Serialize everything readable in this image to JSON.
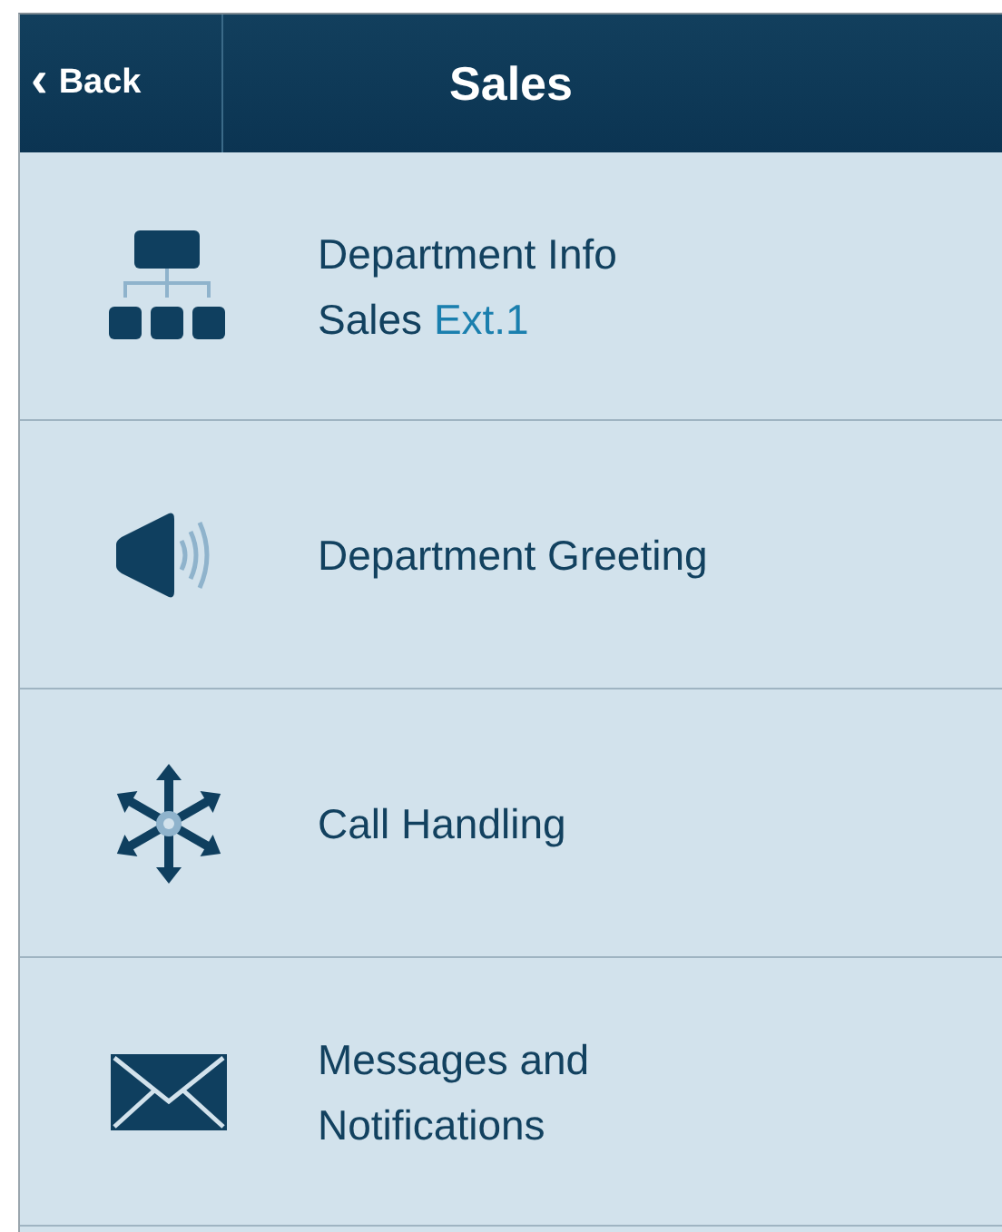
{
  "header": {
    "back": {
      "chevron": "‹",
      "label": "Back"
    },
    "title": "Sales"
  },
  "items": [
    {
      "lines": [
        "Department Info"
      ],
      "detail": {
        "name": "Sales",
        "extension": "Ext.1"
      }
    },
    {
      "lines": [
        "Department Greeting"
      ]
    },
    {
      "lines": [
        "Call Handling"
      ]
    },
    {
      "lines": [
        "Messages and",
        "Notifications"
      ]
    }
  ]
}
